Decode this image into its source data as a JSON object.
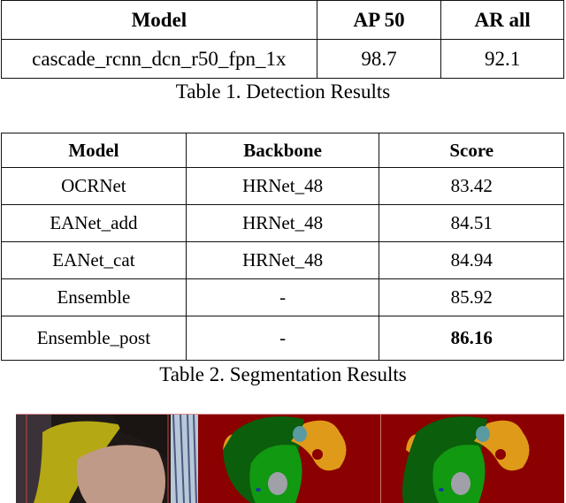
{
  "table1": {
    "headers": [
      "Model",
      "AP 50",
      "AR all"
    ],
    "rows": [
      [
        "cascade_rcnn_dcn_r50_fpn_1x",
        "98.7",
        "92.1"
      ]
    ],
    "caption": "Table 1. Detection Results"
  },
  "table2": {
    "headers": [
      "Model",
      "Backbone",
      "Score"
    ],
    "rows": [
      [
        "OCRNet",
        "HRNet_48",
        "83.42"
      ],
      [
        "EANet_add",
        "HRNet_48",
        "84.51"
      ],
      [
        "EANet_cat",
        "HRNet_48",
        "84.94"
      ],
      [
        "Ensemble",
        "-",
        "85.92"
      ],
      [
        "Ensemble_post",
        "-",
        "86.16"
      ]
    ],
    "bold_cell": "86.16",
    "caption": "Table 2. Segmentation Results"
  },
  "figure": {
    "panels": [
      {
        "label": "input-photo",
        "description": "sleeping person with yellow headscarf"
      },
      {
        "label": "segmentation-prediction-1",
        "description": "face parsing mask"
      },
      {
        "label": "segmentation-prediction-2",
        "description": "face parsing mask"
      }
    ],
    "colors": {
      "background": "#8b0000",
      "hair": "#0b5e0b",
      "skin": "#119911",
      "hat": "#e09a1a",
      "ear": "#5a9aa0",
      "nose": "#a0a0a8",
      "eye": "#1a3a9a"
    }
  }
}
